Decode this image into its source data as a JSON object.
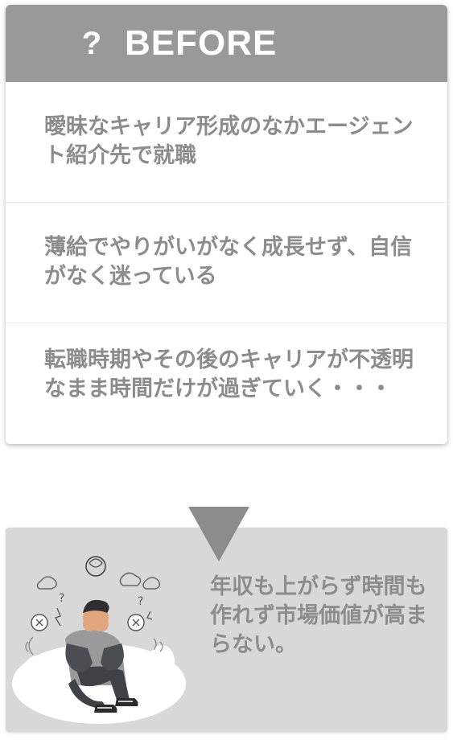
{
  "before_card": {
    "header": {
      "icon": "question-mark-icon",
      "icon_glyph": "?",
      "title": "BEFORE"
    },
    "items": [
      {
        "text": "曖昧なキャリア形成のなかエージェント紹介先で就職"
      },
      {
        "text": "薄給でやりがいがなく成長せず、自信がなく迷っている"
      },
      {
        "text": "転職時期やその後のキャリアが不透明なまま時間だけが過ぎていく・・・"
      }
    ]
  },
  "arrow": {
    "icon": "down-triangle-icon"
  },
  "after_box": {
    "illustration": "stressed-man-illustration",
    "text": "年収も上がらず時間も作れず市場価値が高まらない。"
  },
  "colors": {
    "header_bg": "#999999",
    "text_gray": "#8c8c8c",
    "after_bg": "#d8d8d8",
    "arrow": "#8c8c8c"
  }
}
